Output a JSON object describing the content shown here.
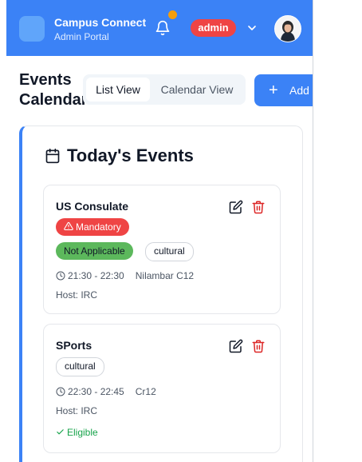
{
  "header": {
    "brand_title": "Campus Connect",
    "brand_subtitle": "Admin Portal",
    "role": "admin",
    "colors": {
      "bar": "#3b82f6",
      "badge": "#ef4444",
      "notification_dot": "#f59e0b"
    },
    "icons": {
      "bell": "bell-icon",
      "chevron": "chevron-down-icon"
    }
  },
  "page": {
    "title": "Events Calendar",
    "view_options": [
      "List View",
      "Calendar View"
    ],
    "active_view": "List View",
    "add_button": "Add Event"
  },
  "today": {
    "title": "Today's Events",
    "events": [
      {
        "name": "US Consulate",
        "mandatory_label": "Mandatory",
        "status": "Not Applicable",
        "tag": "cultural",
        "time": "21:30 - 22:30",
        "location": "Nilambar C12",
        "host": "Host: IRC"
      },
      {
        "name": "SPorts",
        "tag": "cultural",
        "time": "22:30 - 22:45",
        "location": "Cr12",
        "host": "Host: IRC",
        "eligibility": "Eligible"
      }
    ]
  }
}
